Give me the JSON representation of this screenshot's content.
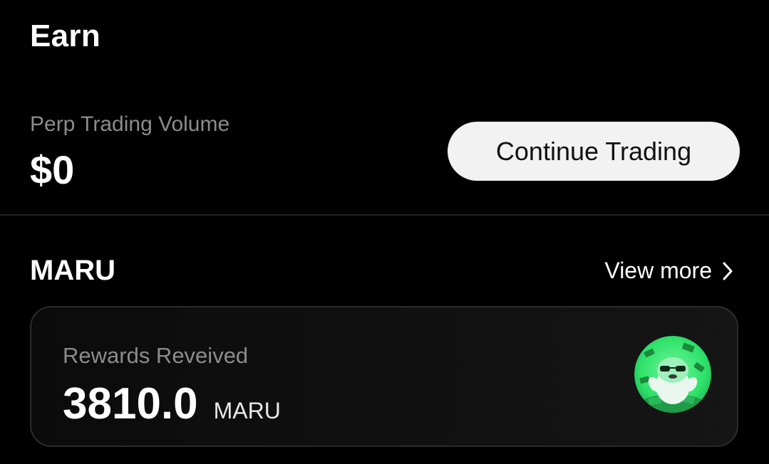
{
  "page": {
    "title": "Earn"
  },
  "volume": {
    "label": "Perp Trading Volume",
    "value": "$0",
    "button_label": "Continue Trading"
  },
  "section": {
    "title": "MARU",
    "view_more_label": "View more"
  },
  "rewards": {
    "label": "Rewards Reveived",
    "amount": "3810.0",
    "unit": "MARU"
  },
  "colors": {
    "background": "#000000",
    "button_bg": "#f2f2f2",
    "muted_text": "#8c8c8c",
    "avatar_green": "#2ee26a"
  },
  "icons": {
    "view_more": "chevron-right-icon",
    "avatar": "maru-mascot-avatar"
  }
}
